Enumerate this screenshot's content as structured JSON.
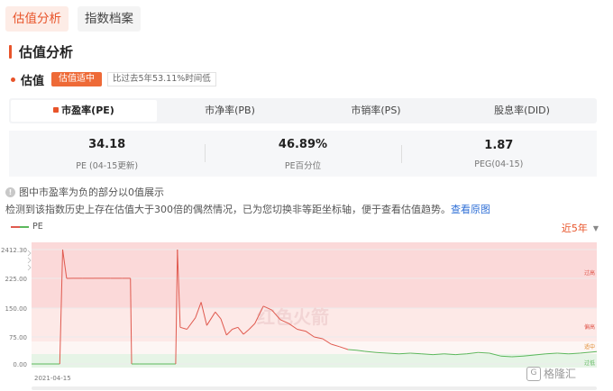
{
  "top_tabs": [
    {
      "label": "估值分析",
      "active": true
    },
    {
      "label": "指数档案",
      "active": false
    }
  ],
  "section": {
    "title": "估值分析"
  },
  "valuation": {
    "label": "估值",
    "badge": "估值适中",
    "note": "比过去5年53.11%时间低"
  },
  "metric_tabs": [
    {
      "label": "市盈率(PE)",
      "active": true
    },
    {
      "label": "市净率(PB)",
      "active": false
    },
    {
      "label": "市销率(PS)",
      "active": false
    },
    {
      "label": "股息率(DID)",
      "active": false
    }
  ],
  "stats": [
    {
      "value": "34.18",
      "label": "PE (04-15更新)"
    },
    {
      "value": "46.89%",
      "label": "PE百分位"
    },
    {
      "value": "1.87",
      "label": "PEG(04-15)"
    }
  ],
  "info": {
    "line1": "图中市盈率为负的部分以0值展示",
    "line2": "检测到该指数历史上存在估值大于300倍的偶然情况，已为您切换非等距坐标轴，便于查看估值趋势。",
    "link": "查看原图"
  },
  "legend": {
    "series_name": "PE"
  },
  "period": {
    "label": "近5年"
  },
  "colors": {
    "accent": "#e8542a",
    "line_high": "#e05a4f",
    "line_low": "#5cb85c"
  },
  "chart_data": {
    "type": "line",
    "series": [
      {
        "name": "PE"
      }
    ],
    "x_start_label": "2021-04-15",
    "y_ticks": [
      "2412.30",
      "225.00",
      "150.00",
      "75.00",
      "0.00"
    ],
    "y_scale": "non-uniform",
    "zones": [
      "过高",
      "偏高",
      "适中",
      "过低"
    ],
    "watermark": "红色火箭",
    "points": [
      [
        0,
        0
      ],
      [
        0.05,
        0
      ],
      [
        0.055,
        2412.3
      ],
      [
        0.062,
        225
      ],
      [
        0.075,
        230
      ],
      [
        0.09,
        230
      ],
      [
        0.11,
        230
      ],
      [
        0.14,
        230
      ],
      [
        0.16,
        230
      ],
      [
        0.175,
        230
      ],
      [
        0.177,
        0
      ],
      [
        0.19,
        0
      ],
      [
        0.24,
        0
      ],
      [
        0.255,
        0
      ],
      [
        0.258,
        2412.3
      ],
      [
        0.263,
        100
      ],
      [
        0.275,
        95
      ],
      [
        0.29,
        125
      ],
      [
        0.3,
        165
      ],
      [
        0.31,
        105
      ],
      [
        0.325,
        140
      ],
      [
        0.335,
        122
      ],
      [
        0.345,
        80
      ],
      [
        0.355,
        95
      ],
      [
        0.365,
        100
      ],
      [
        0.375,
        82
      ],
      [
        0.385,
        95
      ],
      [
        0.395,
        110
      ],
      [
        0.41,
        155
      ],
      [
        0.425,
        145
      ],
      [
        0.44,
        120
      ],
      [
        0.455,
        110
      ],
      [
        0.47,
        95
      ],
      [
        0.485,
        90
      ],
      [
        0.5,
        75
      ],
      [
        0.515,
        70
      ],
      [
        0.53,
        55
      ],
      [
        0.545,
        48
      ],
      [
        0.56,
        40
      ],
      [
        0.575,
        38
      ],
      [
        0.59,
        35
      ],
      [
        0.61,
        32
      ],
      [
        0.63,
        30
      ],
      [
        0.65,
        28
      ],
      [
        0.67,
        30
      ],
      [
        0.69,
        28
      ],
      [
        0.71,
        26
      ],
      [
        0.73,
        28
      ],
      [
        0.75,
        26
      ],
      [
        0.77,
        28
      ],
      [
        0.79,
        32
      ],
      [
        0.81,
        30
      ],
      [
        0.83,
        22
      ],
      [
        0.85,
        20
      ],
      [
        0.87,
        22
      ],
      [
        0.89,
        25
      ],
      [
        0.91,
        28
      ],
      [
        0.93,
        30
      ],
      [
        0.95,
        28
      ],
      [
        0.97,
        30
      ],
      [
        1.0,
        34.18
      ]
    ]
  },
  "watermark": {
    "text": "格隆汇"
  }
}
